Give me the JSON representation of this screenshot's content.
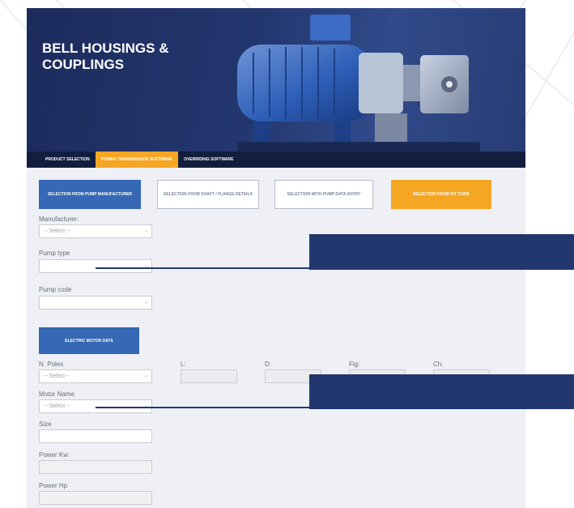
{
  "header": {
    "title_line1": "BELL HOUSINGS &",
    "title_line2": "COUPLINGS"
  },
  "nav": {
    "items": [
      {
        "label": "PRODUCT SELECTION",
        "active": false
      },
      {
        "label": "POWER TRANSMISSION SOFTWARE",
        "active": true
      },
      {
        "label": "OVERRIDING SOFTWARE",
        "active": false
      }
    ]
  },
  "selection_buttons": [
    {
      "label": "SELECTION FROM PUMP MANUFACTURER",
      "style": "blue"
    },
    {
      "label": "SELECTION FROM SHAFT / FLANGE DETAILS",
      "style": "outline"
    },
    {
      "label": "SELECTION WITH PUMP DATA ENTRY",
      "style": "outline"
    },
    {
      "label": "SELECTION FROM KIT CODE",
      "style": "orange"
    }
  ],
  "form": {
    "manufacturer": {
      "label": "Manufacturer:",
      "value": "-- Select --"
    },
    "pump_type": {
      "label": "Pump type",
      "value": ""
    },
    "pump_code": {
      "label": "Pump code",
      "value": ""
    }
  },
  "motor_section": {
    "button_label": "ELECTRIC MOTOR DATA",
    "n_poles": {
      "label": "N. Poles",
      "value": "-- Select --"
    },
    "motor_name": {
      "label": "Motor Name",
      "value": "-- Select --"
    },
    "size": {
      "label": "Size",
      "value": ""
    },
    "power_kw": {
      "label": "Power Kw",
      "value": ""
    },
    "power_hp": {
      "label": "Power Hp",
      "value": ""
    },
    "dims": [
      {
        "label": "L:"
      },
      {
        "label": "D:"
      },
      {
        "label": "Fig:"
      },
      {
        "label": "Ch:"
      }
    ]
  },
  "colors": {
    "header_bg": "#23376f",
    "nav_bg": "#131d3e",
    "accent_orange": "#f5a623",
    "button_blue": "#3568b5",
    "callout_navy": "#23376f",
    "form_bg": "#eef0f5"
  },
  "icons": {
    "dropdown": "chevron-down-icon"
  }
}
